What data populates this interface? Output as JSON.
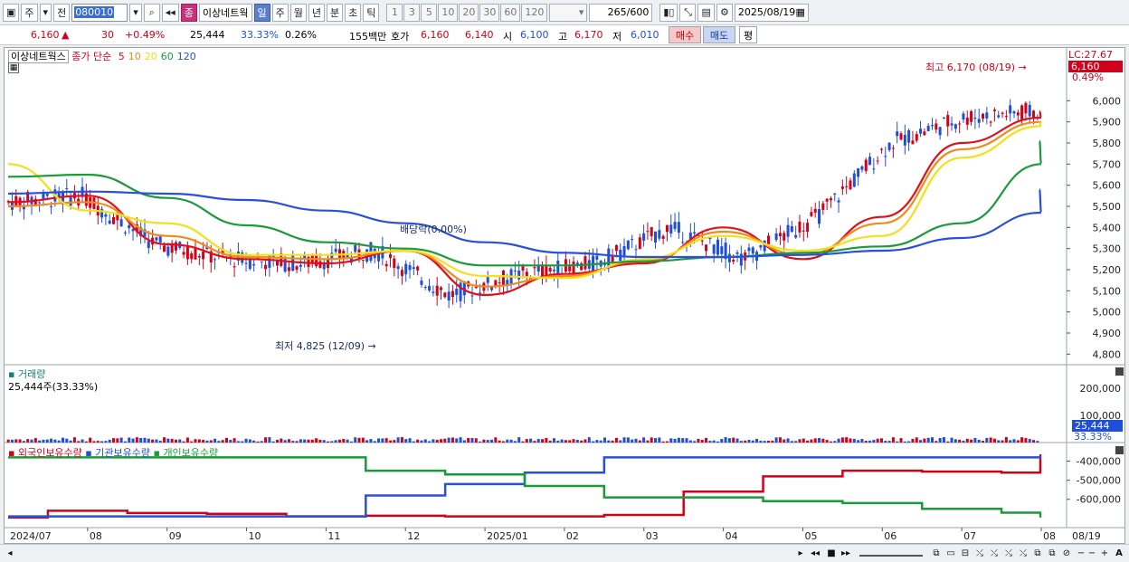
{
  "toolbar": {
    "period_type": "주",
    "prev_label": "전",
    "code": "080010",
    "badge": "종",
    "stock_name": "이상네트웍",
    "periods": [
      "일",
      "주",
      "월",
      "년",
      "분",
      "초",
      "틱"
    ],
    "active_period": "일",
    "intervals": [
      "1",
      "3",
      "5",
      "10",
      "20",
      "30",
      "60",
      "120"
    ],
    "count": "265",
    "count_max": "/600",
    "date": "2025/08/19"
  },
  "quote": {
    "price": "6,160",
    "change": "30",
    "change_pct": "+0.49%",
    "volume": "25,444",
    "volume_ratio": "33.33%",
    "turnover": "0.26%",
    "trade_value": "155백만",
    "bid_label": "호가",
    "bid": "6,160",
    "ask": "6,140",
    "open_label": "시",
    "open": "6,100",
    "high_label": "고",
    "high": "6,170",
    "low_label": "저",
    "low": "6,010",
    "buy_label": "매수",
    "sell_label": "매도",
    "eval_label": "평"
  },
  "price_pane": {
    "title": "이상네트웍스",
    "ma_label": "종가 단순",
    "ma_periods": [
      "5",
      "10",
      "20",
      "60",
      "120"
    ],
    "lc_label": "LC:27.67",
    "price_tag": "6,160",
    "price_tag_pct": "0.49%",
    "high_annotation": "최고 6,170 (08/19)",
    "low_annotation": "최저 4,825 (12/09)",
    "dividend_annotation": "배당락(0.00%)"
  },
  "volume_pane": {
    "title": "거래량",
    "subtitle": "25,444주(33.33%)",
    "tag": "25,444",
    "tag_pct": "33.33%"
  },
  "holding_pane": {
    "legend": [
      "외국인보유수량",
      "기관보유수량",
      "개인보유수량"
    ]
  },
  "colors": {
    "up": "#d0021b",
    "down": "#1f4ed8",
    "ma5": "#e0101a",
    "ma10": "#f08a1a",
    "ma20": "#f2e01a",
    "ma60": "#1a9a3a",
    "ma120": "#2a50d8"
  },
  "chart_data": [
    {
      "type": "line",
      "title": "",
      "note": "price candlestick pane with moving averages (values approximated from the visible scale)",
      "x": [
        "2024/07",
        "08",
        "09",
        "10",
        "11",
        "12",
        "2025/01",
        "02",
        "03",
        "04",
        "05",
        "06",
        "07",
        "08",
        "08/19"
      ],
      "y_ticks": [
        4800,
        4900,
        5000,
        5100,
        5200,
        5300,
        5400,
        5500,
        5600,
        5700,
        5800,
        5900,
        6000
      ],
      "ylim": [
        4750,
        6250
      ],
      "series": [
        {
          "name": "5",
          "values": [
            5520,
            5550,
            5320,
            5250,
            5230,
            5290,
            5080,
            5180,
            5230,
            5400,
            5250,
            5450,
            5800,
            5920,
            5950
          ]
        },
        {
          "name": "10",
          "values": [
            5500,
            5520,
            5360,
            5260,
            5250,
            5290,
            5120,
            5170,
            5240,
            5380,
            5270,
            5420,
            5770,
            5900,
            5890
          ]
        },
        {
          "name": "20",
          "values": [
            5700,
            5480,
            5420,
            5270,
            5270,
            5290,
            5170,
            5160,
            5250,
            5360,
            5290,
            5360,
            5730,
            5880,
            5900
          ]
        },
        {
          "name": "60",
          "values": [
            5640,
            5650,
            5540,
            5410,
            5330,
            5300,
            5220,
            5220,
            5240,
            5260,
            5280,
            5310,
            5420,
            5700,
            5810
          ]
        },
        {
          "name": "120",
          "values": [
            5560,
            5570,
            5560,
            5530,
            5480,
            5420,
            5330,
            5280,
            5260,
            5260,
            5270,
            5290,
            5350,
            5470,
            5580
          ]
        }
      ],
      "extremes": {
        "high": 6170,
        "high_date": "08/19",
        "low": 4825,
        "low_date": "12/09"
      }
    },
    {
      "type": "bar",
      "title": "",
      "y_ticks": [
        100000,
        200000
      ],
      "ylim": [
        0,
        280000
      ],
      "last_volume": 25444
    },
    {
      "type": "line",
      "title": "",
      "y_ticks": [
        -400000,
        -500000,
        -600000
      ],
      "series": [
        {
          "name": "외국인보유수량",
          "values": [
            -695000,
            -660000,
            -672000,
            -676000,
            -690000,
            -686000,
            -690000,
            -690000,
            -682000,
            -560000,
            -480000,
            -450000,
            -455000,
            -460000,
            -370000
          ]
        },
        {
          "name": "기관보유수량",
          "values": [
            -690000,
            -690000,
            -690000,
            -690000,
            -690000,
            -580000,
            -520000,
            -460000,
            -380000,
            -380000,
            -380000,
            -380000,
            -380000,
            -380000,
            -380000
          ]
        },
        {
          "name": "개인보유수량",
          "values": [
            -380000,
            -380000,
            -380000,
            -380000,
            -380000,
            -450000,
            -470000,
            -530000,
            -590000,
            -590000,
            -610000,
            -620000,
            -650000,
            -670000,
            -690000
          ]
        }
      ]
    }
  ]
}
